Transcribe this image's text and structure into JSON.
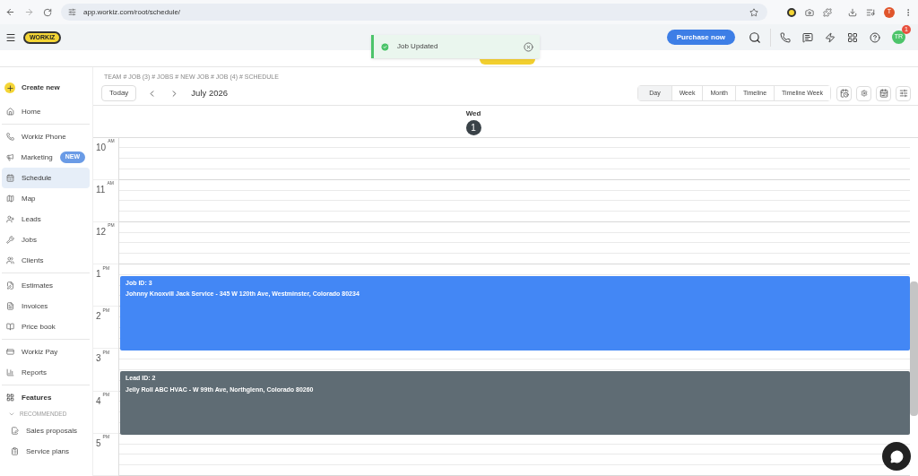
{
  "browser": {
    "url": "app.workiz.com/root/schedule/",
    "profile_initial": "T"
  },
  "header": {
    "logo": "WORKIZ",
    "purchase_button": "Purchase now",
    "avatar": "TR",
    "notification_count": "1"
  },
  "toast": {
    "message": "Job Updated"
  },
  "sidebar": {
    "create_button": "Create new",
    "groups": [
      [
        {
          "label": "Home",
          "selected": false
        }
      ],
      [
        {
          "label": "Workiz Phone",
          "selected": false
        },
        {
          "label": "Marketing",
          "selected": false,
          "badge": "NEW"
        },
        {
          "label": "Schedule",
          "selected": true
        },
        {
          "label": "Map",
          "selected": false
        },
        {
          "label": "Leads",
          "selected": false
        },
        {
          "label": "Jobs",
          "selected": false
        },
        {
          "label": "Clients",
          "selected": false
        }
      ],
      [
        {
          "label": "Estimates",
          "selected": false
        },
        {
          "label": "Invoices",
          "selected": false
        },
        {
          "label": "Price book",
          "selected": false
        }
      ],
      [
        {
          "label": "Workiz Pay",
          "selected": false
        },
        {
          "label": "Reports",
          "selected": false
        }
      ]
    ],
    "features": {
      "label": "Features",
      "section": "RECOMMENDED",
      "expanded": true,
      "items": [
        {
          "label": "Sales proposals"
        },
        {
          "label": "Service plans"
        }
      ]
    }
  },
  "breadcrumb": "TEAM # JOB (3) # JOBS # NEW JOB # JOB (4) # SCHEDULE",
  "toolbar": {
    "today": "Today",
    "month": "July 2026",
    "views": [
      {
        "label": "Day",
        "selected": true
      },
      {
        "label": "Week",
        "selected": false
      },
      {
        "label": "Month",
        "selected": false
      },
      {
        "label": "Timeline",
        "selected": false
      },
      {
        "label": "Timeline Week",
        "selected": false
      }
    ]
  },
  "day_header": {
    "weekday": "Wed",
    "date": "1"
  },
  "hours": [
    {
      "hour": "10",
      "ampm": "AM"
    },
    {
      "hour": "11",
      "ampm": "AM"
    },
    {
      "hour": "12",
      "ampm": "PM"
    },
    {
      "hour": "1",
      "ampm": "PM"
    },
    {
      "hour": "2",
      "ampm": "PM"
    },
    {
      "hour": "3",
      "ampm": "PM"
    },
    {
      "hour": "4",
      "ampm": "PM"
    },
    {
      "hour": "5",
      "ampm": "PM"
    }
  ],
  "events": [
    {
      "title": "Job ID: 3",
      "details": "Johnny Knoxvill Jack Service - 345 W 120th Ave, Westminster, Colorado 80234",
      "color": "#4387f5"
    },
    {
      "title": "Lead ID: 2",
      "details": "Jelly Roll ABC HVAC - W 99th Ave, Northglenn, Colorado 80260",
      "color": "#5f6c74"
    }
  ]
}
